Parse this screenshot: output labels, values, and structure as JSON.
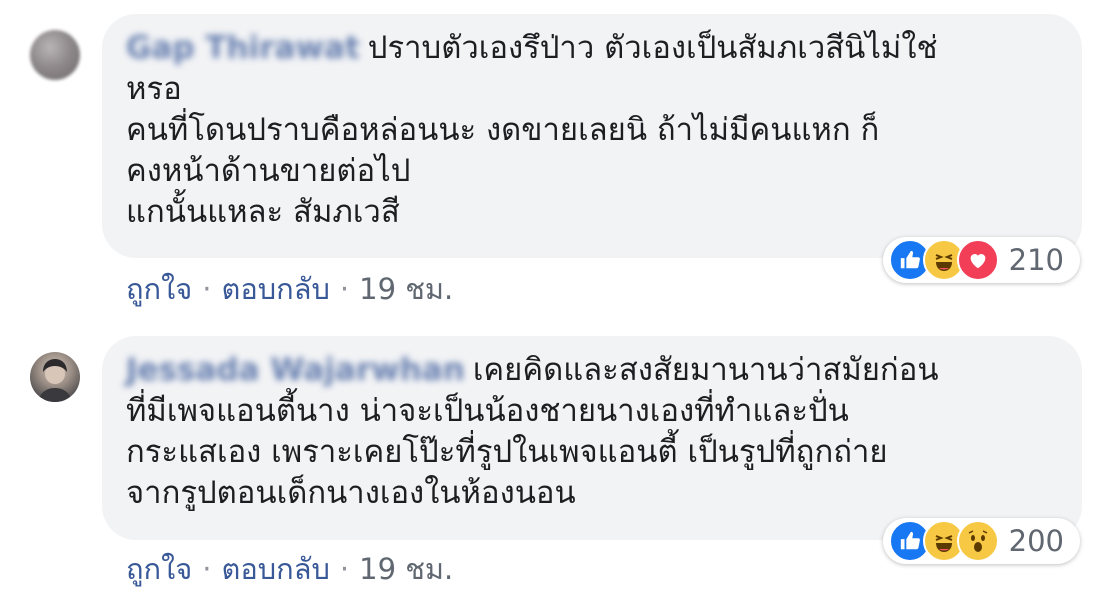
{
  "comments": [
    {
      "author": "Gap Thirawat",
      "text": "ปราบตัวเองรึป่าว ตัวเองเป็นสัมภเวสีนิไม่ใช่\nหรอ\nคนที่โดนปราบคือหล่อนนะ งดขายเลยนิ ถ้าไม่มีคนแหก ก็\nคงหน้าด้านขายต่อไป\nแกนั้นแหละ สัมภเวสี",
      "reaction_icons": [
        "like-icon",
        "haha-icon",
        "love-icon"
      ],
      "reaction_count": "210",
      "like_label": "ถูกใจ",
      "reply_label": "ตอบกลับ",
      "separator": "·",
      "time": "19 ชม."
    },
    {
      "author": "Jessada Wajarwhan",
      "text": "เคยคิดและสงสัยมานานว่าสมัยก่อน\nที่มีเพจแอนตี้นาง น่าจะเป็นน้องชายนางเองที่ทำและปั่น\nกระแสเอง เพราะเคยโป๊ะที่รูปในเพจแอนตี้ เป็นรูปที่ถูกถ่าย\nจากรูปตอนเด็กนางเองในห้องนอน",
      "reaction_icons": [
        "like-icon",
        "haha-icon",
        "wow-icon"
      ],
      "reaction_count": "200",
      "like_label": "ถูกใจ",
      "reply_label": "ตอบกลับ",
      "separator": "·",
      "time": "19 ชม."
    }
  ],
  "colors": {
    "bubble": "#f2f3f5",
    "link": "#385898",
    "meta": "#606770",
    "like": "#1877f2",
    "love": "#f33e58",
    "haha": "#f7c843"
  }
}
